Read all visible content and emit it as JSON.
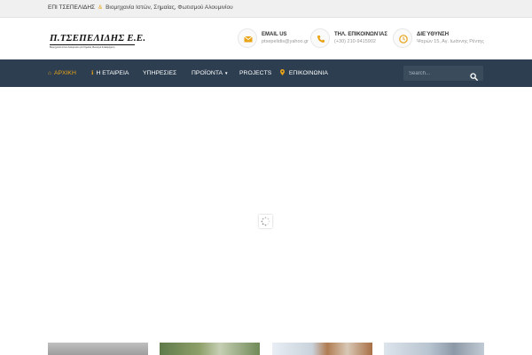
{
  "topbar": {
    "brand": "ΕΠΙ ΤΣΕΠΕΛΙΔΗΣ",
    "separator": "&",
    "tagline": "Βιομηχανία Ιστών, Σημαίας, Φωτισμού Αλουμινίου"
  },
  "logo": {
    "title": "Π.ΤΣΕΠΕΛΙΔΗΣ Ε.Ε.",
    "tagline": "Βιομηχανία Ιστών Αλουμινίου για Σημαίες Φωτισμό & Διαφήμιση"
  },
  "contacts": {
    "email": {
      "label": "EMAIL US",
      "value": "ptsepelidis@yahoo.gr",
      "icon": "envelope-icon"
    },
    "phone": {
      "label": "ΤΗΛ. ΕΠΙΚΟΙΝΩΝΊΑΣ",
      "value": "(+30) 210-9415902",
      "icon": "phone-icon"
    },
    "address": {
      "label": "ΔΙΕΎΘΥΝΣΗ",
      "value": "Ψαρών 15, Αγ. Ιωάννης Ρέντης",
      "icon": "clock-icon"
    }
  },
  "nav": {
    "items": [
      {
        "label": "ΑΡΧΙΚΗ",
        "icon": "home-icon",
        "active": true
      },
      {
        "label": "Η ΕΤΑΙΡΕΙΑ",
        "icon": "info-icon"
      },
      {
        "label": "ΥΠΗΡΕΣΙΕΣ"
      },
      {
        "label": "ΠΡΟΪΟΝΤΑ",
        "has_dropdown": true
      },
      {
        "label": "PROJECTS"
      },
      {
        "label": "ΕΠΙΚΟΙΝΩΝΙΑ",
        "icon": "map-marker-icon"
      }
    ],
    "search_placeholder": "Search..."
  },
  "colors": {
    "accent": "#e8a317",
    "nav_background": "#2d3e50",
    "topbar_background": "#f0f0f0"
  }
}
